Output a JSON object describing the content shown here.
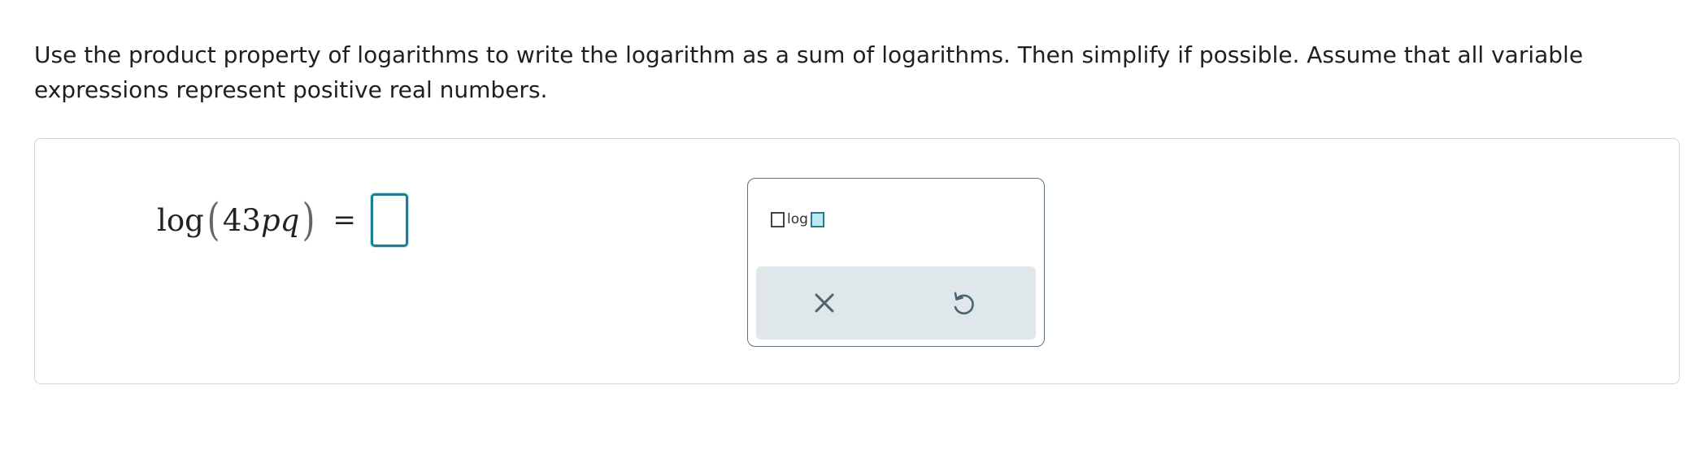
{
  "instructions": "Use the product property of logarithms to write the logarithm as a sum of logarithms. Then simplify if possible. Assume that all variable expressions represent positive real numbers.",
  "equation": {
    "func": "log",
    "open_paren": "(",
    "coefficient": "43",
    "var1": "p",
    "var2": "q",
    "close_paren": ")",
    "equals": "="
  },
  "answer_input": {
    "value": ""
  },
  "palette": {
    "template_label": "log",
    "clear_icon": "close-x-icon",
    "undo_icon": "undo-arrow-icon"
  },
  "colors": {
    "accent": "#1a7f92",
    "panel_border": "#cdd6da",
    "action_bar": "#e0e7ea",
    "icon": "#4a6470"
  }
}
